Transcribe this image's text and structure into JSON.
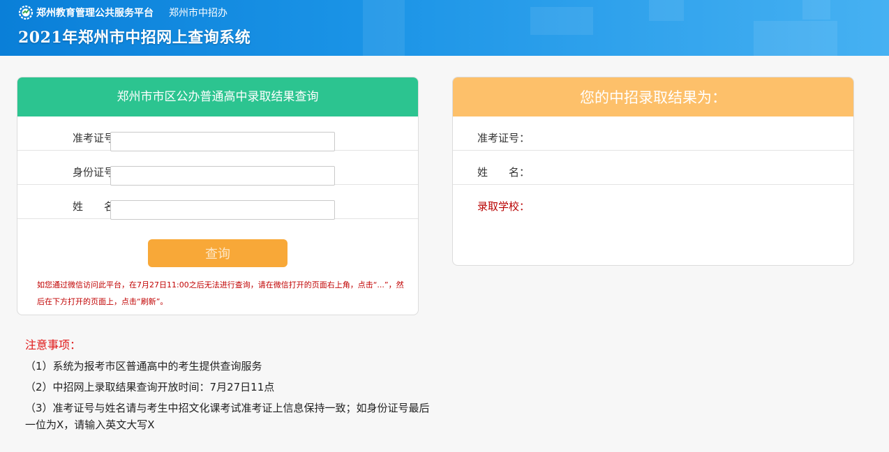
{
  "header": {
    "platform_name": "郑州教育管理公共服务平台",
    "office_name": "郑州市中招办",
    "system_title": "2021年郑州市中招网上查询系统"
  },
  "query_panel": {
    "title": "郑州市市区公办普通高中录取结果查询",
    "fields": [
      {
        "label": "准考证号：",
        "value": "",
        "placeholder": ""
      },
      {
        "label": "身份证号：",
        "value": "",
        "placeholder": ""
      },
      {
        "label": "姓　　名：",
        "value": "",
        "placeholder": ""
      }
    ],
    "submit_label": "查询",
    "wechat_note": "如您通过微信访问此平台，在7月27日11:00之后无法进行查询，请在微信打开的页面右上角，点击“...”，然后在下方打开的页面上，点击“刷新”。"
  },
  "notes": {
    "title": "注意事项：",
    "items": [
      "（1）系统为报考市区普通高中的考生提供查询服务",
      "（2）中招网上录取结果查询开放时间：7月27日11点",
      "（3）准考证号与姓名请与考生中招文化课考试准考证上信息保持一致；如身份证号最后一位为X，请输入英文大写X"
    ]
  },
  "result_panel": {
    "title": "您的中招录取结果为：",
    "rows": [
      {
        "label": "准考证号：",
        "value": ""
      },
      {
        "label": "姓　　名：",
        "value": ""
      },
      {
        "label": "录取学校：",
        "value": ""
      }
    ]
  },
  "colors": {
    "banner": "#1a93e6",
    "query_header": "#2cc490",
    "result_header": "#fdc06a",
    "button": "#f8a838",
    "warning_text": "#c00000",
    "notes_title": "#e01818"
  },
  "icons": {
    "logo": "gear-globe-logo-icon"
  }
}
